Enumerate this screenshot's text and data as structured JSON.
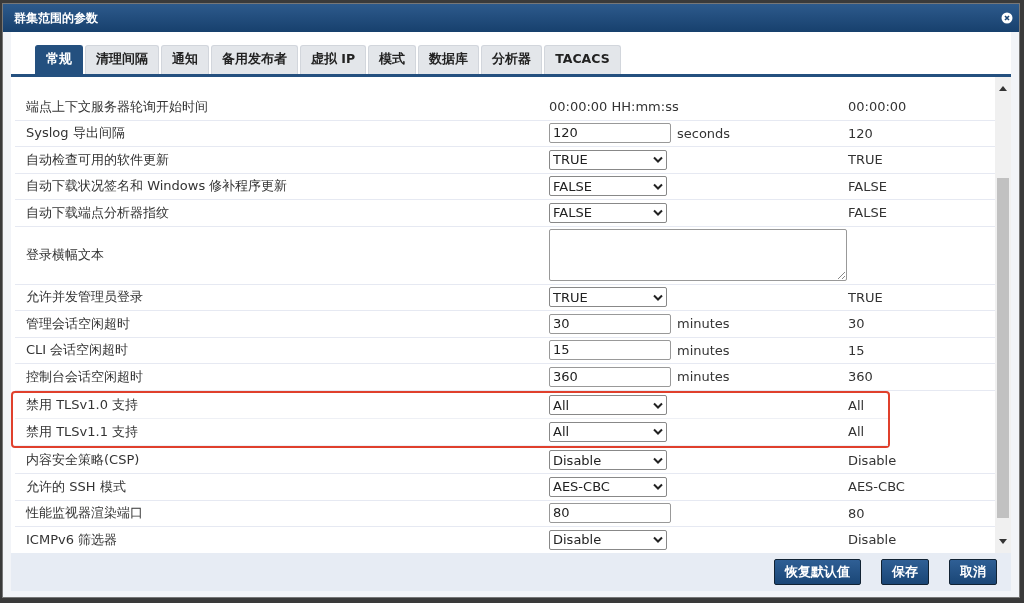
{
  "window": {
    "title": "群集范围的参数"
  },
  "tabs": [
    {
      "label": "常规",
      "selected": true
    },
    {
      "label": "清理间隔",
      "selected": false
    },
    {
      "label": "通知",
      "selected": false
    },
    {
      "label": "备用发布者",
      "selected": false
    },
    {
      "label": "虚拟 IP",
      "selected": false
    },
    {
      "label": "模式",
      "selected": false
    },
    {
      "label": "数据库",
      "selected": false
    },
    {
      "label": "分析器",
      "selected": false
    },
    {
      "label": "TACACS",
      "selected": false
    }
  ],
  "rows": [
    {
      "label": "端点上下文服务器轮询开始时间",
      "kind": "static",
      "value": "00:00:00 HH:mm:ss",
      "default": "00:00:00",
      "highlighted": false
    },
    {
      "label": "Syslog 导出间隔",
      "kind": "input",
      "value": "120",
      "unit": "seconds",
      "default": "120",
      "highlighted": false
    },
    {
      "label": "自动检查可用的软件更新",
      "kind": "select",
      "value": "TRUE",
      "default": "TRUE",
      "highlighted": false
    },
    {
      "label": "自动下载状况签名和 Windows 修补程序更新",
      "kind": "select",
      "value": "FALSE",
      "default": "FALSE",
      "highlighted": false
    },
    {
      "label": "自动下载端点分析器指纹",
      "kind": "select",
      "value": "FALSE",
      "default": "FALSE",
      "highlighted": false
    },
    {
      "label": "登录横幅文本",
      "kind": "textarea",
      "highlighted": false
    },
    {
      "label": "允许并发管理员登录",
      "kind": "select",
      "value": "TRUE",
      "default": "TRUE",
      "highlighted": false
    },
    {
      "label": "管理会话空闲超时",
      "kind": "input",
      "value": "30",
      "unit": "minutes",
      "default": "30",
      "highlighted": false
    },
    {
      "label": "CLI 会话空闲超时",
      "kind": "input",
      "value": "15",
      "unit": "minutes",
      "default": "15",
      "highlighted": false
    },
    {
      "label": "控制台会话空闲超时",
      "kind": "input",
      "value": "360",
      "unit": "minutes",
      "default": "360",
      "highlighted": false
    },
    {
      "label": "禁用 TLSv1.0 支持",
      "kind": "select",
      "value": "All",
      "default": "All",
      "highlighted": true
    },
    {
      "label": "禁用 TLSv1.1 支持",
      "kind": "select",
      "value": "All",
      "default": "All",
      "highlighted": true
    },
    {
      "label": "内容安全策略(CSP)",
      "kind": "select",
      "value": "Disable",
      "default": "Disable",
      "highlighted": false
    },
    {
      "label": "允许的 SSH 模式",
      "kind": "select",
      "value": "AES-CBC",
      "default": "AES-CBC",
      "highlighted": false
    },
    {
      "label": "性能监视器渲染端口",
      "kind": "input",
      "value": "80",
      "default": "80",
      "highlighted": false
    },
    {
      "label": "ICMPv6 筛选器",
      "kind": "select",
      "value": "Disable",
      "default": "Disable",
      "highlighted": false
    }
  ],
  "buttons": [
    "恢复默认值",
    "保存",
    "取消"
  ]
}
